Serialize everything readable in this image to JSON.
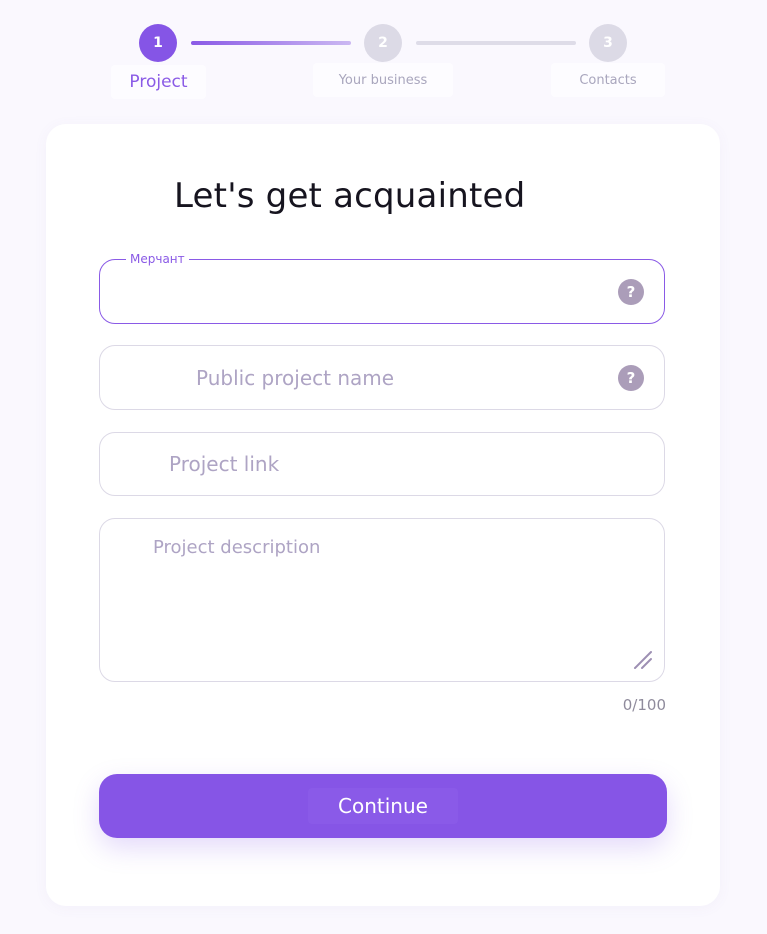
{
  "stepper": {
    "steps": [
      {
        "number": "1",
        "label": "Project",
        "state": "active"
      },
      {
        "number": "2",
        "label": "Your business",
        "state": "inactive"
      },
      {
        "number": "3",
        "label": "Contacts",
        "state": "inactive"
      }
    ]
  },
  "form": {
    "title": "Let's get acquainted",
    "merchant": {
      "label": "Мерчант",
      "value": "",
      "help": "?"
    },
    "public_project_name": {
      "placeholder": "Public project name",
      "help": "?"
    },
    "project_link": {
      "placeholder": "Project link"
    },
    "project_description": {
      "placeholder": "Project description",
      "counter": "0/100"
    },
    "continue_label": "Continue"
  },
  "colors": {
    "accent": "#8655e6",
    "inactive_step": "#dcdae6",
    "help_icon": "#ab9db9",
    "placeholder": "#aea4c4",
    "background": "#faf8fe"
  }
}
